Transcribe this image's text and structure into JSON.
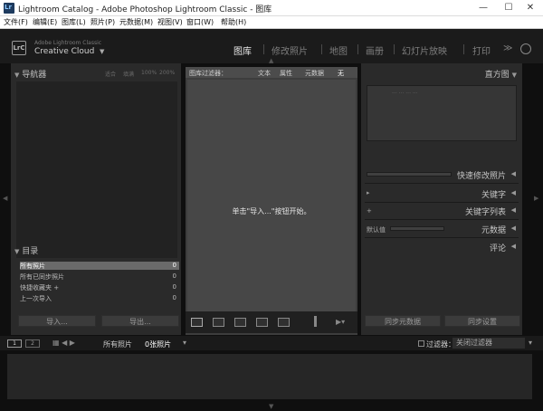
{
  "window": {
    "title": "Lightroom Catalog - Adobe Photoshop Lightroom Classic - 图库",
    "controls": [
      "—",
      "☐",
      "✕"
    ]
  },
  "menubar": {
    "items": [
      "文件(F)",
      "编辑(E)",
      "图库(L)",
      "照片(P)",
      "元数据(M)",
      "视图(V)",
      "窗口(W)",
      "帮助(H)"
    ]
  },
  "identity": {
    "logo": "LrC",
    "line1": "Adobe Lightroom Classic",
    "line2": "Creative Cloud",
    "arrow": "▼"
  },
  "modules": {
    "items": [
      "图库",
      "修改照片",
      "地图",
      "画册",
      "幻灯片放映",
      "打印",
      "≫"
    ],
    "active": "图库"
  },
  "left_panel": {
    "navigator_title": "导航器",
    "navigator_options": [
      "适合",
      "填满",
      "100%",
      "200%"
    ],
    "catalog_title": "目录",
    "catalog_items": [
      {
        "label": "所有照片",
        "count": "0"
      },
      {
        "label": "所有已同步照片",
        "count": "0"
      },
      {
        "label": "快捷收藏夹 +",
        "count": "0"
      },
      {
        "label": "上一次导入",
        "count": "0"
      }
    ],
    "import_button": "导入...",
    "export_button": "导出..."
  },
  "filter_bar": {
    "title": "图库过滤器：",
    "options": [
      "文本",
      "属性",
      "元数据",
      "无"
    ]
  },
  "center": {
    "hint": "单击\"导入...\"按钮开始。"
  },
  "toolbar": {
    "tools": [
      "grid-view",
      "loupe-view",
      "compare-view",
      "survey-view",
      "people-view"
    ]
  },
  "right_panel": {
    "histogram_title": "直方图",
    "histogram_sub": "... ... ... ...",
    "quick_develop": "快速修改照片",
    "keywording": "关键字",
    "keyword_list": "关键字列表",
    "keyword_list_marker": "+",
    "metadata": "元数据",
    "metadata_preset": "默认值",
    "comments": "评论",
    "sync_metadata": "同步元数据",
    "sync_settings": "同步设置"
  },
  "filmstrip_bar": {
    "views": [
      "1",
      "2"
    ],
    "location": "所有照片",
    "count": "0张照片",
    "filter_label": "过滤器：",
    "filter_value": "关闭过滤器"
  },
  "colors": {
    "accent": "#e8e8e8",
    "panel": "#2a2a2a",
    "center": "#3d3d3d"
  }
}
